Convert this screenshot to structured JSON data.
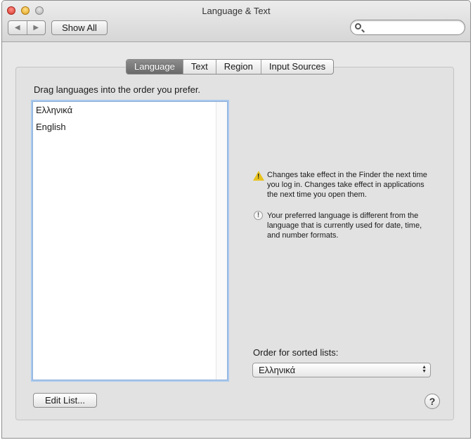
{
  "window": {
    "title": "Language & Text"
  },
  "toolbar": {
    "back_icon": "◀",
    "forward_icon": "▶",
    "show_all_label": "Show All",
    "search": {
      "value": "",
      "placeholder": ""
    }
  },
  "tabs": [
    {
      "label": "Language",
      "active": true
    },
    {
      "label": "Text",
      "active": false
    },
    {
      "label": "Region",
      "active": false
    },
    {
      "label": "Input Sources",
      "active": false
    }
  ],
  "language": {
    "instruction": "Drag languages into the order you prefer.",
    "languages": [
      "Ελληνικά",
      "English"
    ],
    "warning_text": "Changes take effect in the Finder the next time you log in. Changes take effect in applications the next time you open them.",
    "notice_text": "Your preferred language is different from the language that is currently used for date, time, and number formats.",
    "sort_label": "Order for sorted lists:",
    "sort_value": "Ελληνικά",
    "edit_list_label": "Edit List...",
    "help_label": "?"
  },
  "icons": {
    "warning": "warning-icon",
    "notice": "exclamation-icon",
    "search": "search-icon",
    "select": "up-down-arrows-icon"
  },
  "colors": {
    "active_tab": "#7a7a7a",
    "focus_ring": "#a9c8ee",
    "warning_icon": "#e7c21c"
  }
}
